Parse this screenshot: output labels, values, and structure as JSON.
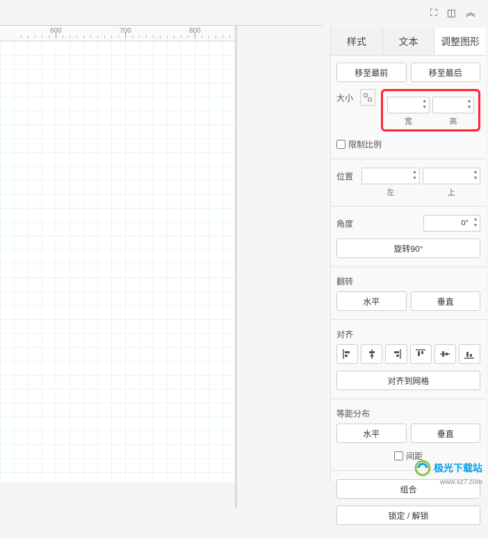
{
  "toolbar": {
    "fullscreen_icon": "⛶",
    "panel_icon": "◫",
    "collapse_icon": "︽"
  },
  "ruler": {
    "marks": [
      "600",
      "700",
      "800"
    ]
  },
  "tabs": {
    "style": "样式",
    "text": "文本",
    "shape": "调整图形"
  },
  "order": {
    "front": "移至最前",
    "back": "移至最后"
  },
  "size": {
    "label": "大小",
    "width_label": "宽",
    "height_label": "高",
    "constrain": "限制比例"
  },
  "position": {
    "label": "位置",
    "left_label": "左",
    "top_label": "上"
  },
  "angle": {
    "label": "角度",
    "value": "0°",
    "rotate90": "旋转90°"
  },
  "flip": {
    "label": "翻转",
    "horizontal": "水平",
    "vertical": "垂直"
  },
  "align": {
    "label": "对齐",
    "snap_grid": "对齐到网格"
  },
  "distribute": {
    "label": "等距分布",
    "horizontal": "水平",
    "vertical": "垂直",
    "spacing": "间距"
  },
  "group": {
    "group": "组合",
    "lock": "锁定 / 解锁"
  },
  "watermark": {
    "text": "极光下载站",
    "url": "www.xz7.com"
  }
}
